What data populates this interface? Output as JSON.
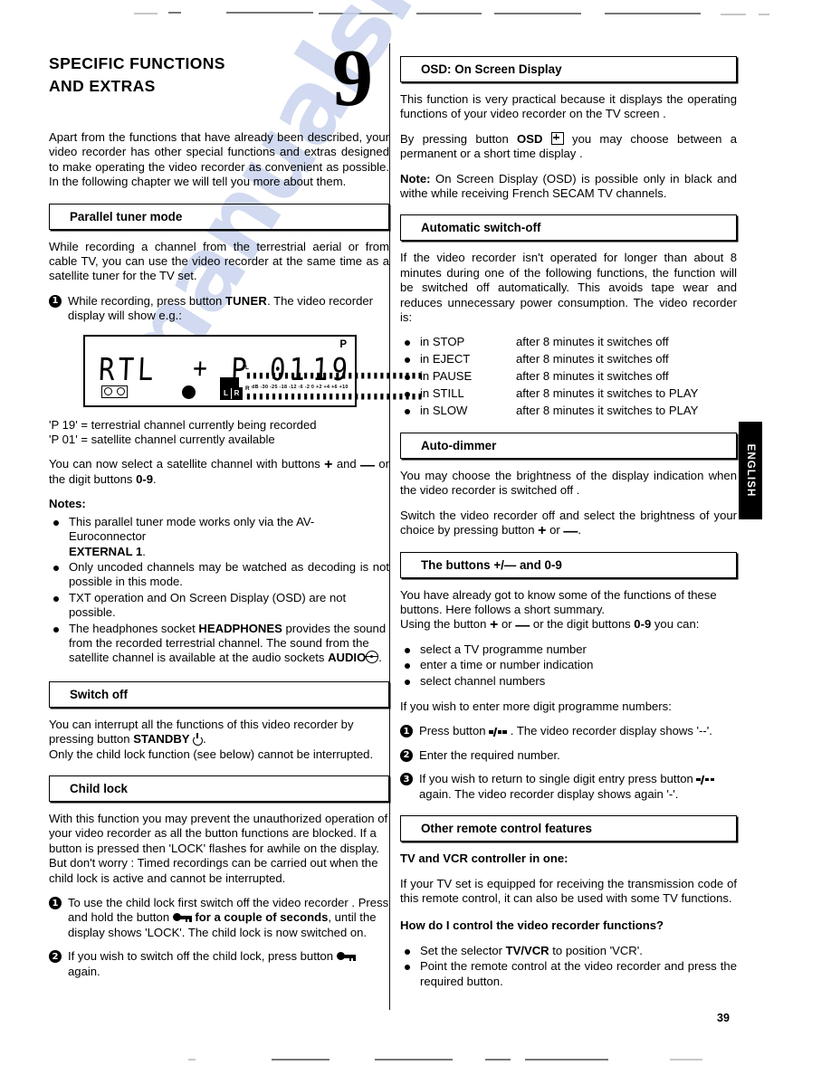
{
  "page": {
    "number": "39",
    "language_tab": "ENGLISH",
    "watermark": "manualslib.com"
  },
  "chapter": {
    "title_line1": "SPECIFIC FUNCTIONS",
    "title_line2": "AND EXTRAS",
    "number": "9",
    "intro": "Apart from the functions that have already been described, your video recorder has other special functions and extras designed to make operating the video recorder as convenient as possible. In the following chapter we will tell you more about them."
  },
  "left": {
    "parallel_tuner": {
      "heading": "Parallel tuner mode",
      "intro": "While recording a channel from the terrestrial aerial or from cable TV, you can use the video recorder at the same time as a satellite tuner for the TV set.",
      "step1_a": "While recording, press button",
      "step1_button": "TUNER",
      "step1_b": ". The video recorder display will show e.g.:",
      "display": {
        "channel_name": "RTL",
        "separator": "+",
        "programme_label": "P",
        "programme_number": "01",
        "terrestrial_number": "19",
        "p_indicator": "P",
        "left_channel_label": "L",
        "right_channel_label": "R",
        "meter_left_tag": "L",
        "meter_right_tag": "R",
        "meter_scale": "dB -30 -25 -18 -12  -6  -2  0 +2  +4  +6  +10",
        "bars": "▮▮▮▮▮▮▮▮▮▮▮▮▮▮▮▮▮▮▮▮▮▮▮▮▮▮▮▮"
      },
      "legend1": "'P 19' = terrestrial channel currently being recorded",
      "legend2": "'P 01' = satellite channel currently available",
      "select_a": "You can now select a satellite channel with buttons",
      "select_plus": "+",
      "select_and": "and",
      "select_minus": "—",
      "select_b": "or the digit buttons",
      "select_digits": "0-9",
      "select_c": ".",
      "notes_title": "Notes:",
      "notes": [
        {
          "text_a": "This parallel tuner mode works only via the AV-Euroconnector",
          "bold": "EXTERNAL 1",
          "text_b": "."
        },
        {
          "text_a": "Only uncoded channels may be watched as decoding is not possible in this mode.",
          "bold": "",
          "text_b": ""
        },
        {
          "text_a": "TXT operation and On Screen Display (OSD) are not possible.",
          "bold": "",
          "text_b": ""
        },
        {
          "text_a": "The headphones socket",
          "bold": "HEADPHONES",
          "text_b": "provides the sound from the recorded terrestrial channel. The sound from the satellite channel is available at the audio sockets",
          "bold2": "AUDIO",
          "text_c": "."
        }
      ]
    },
    "switch_off": {
      "heading": "Switch off",
      "body_a": "You can interrupt all the functions of this video recorder by pressing button",
      "button": "STANDBY",
      "body_b": ".",
      "body_c": "Only the child lock function (see below) cannot be interrupted."
    },
    "child_lock": {
      "heading": "Child lock",
      "body": "With this function you may prevent the unauthorized operation of your video recorder as all the button functions are blocked. If a button is pressed then 'LOCK' flashes for awhile on the display. But don't worry : Timed recordings can be carried out when the child lock is active and cannot be interrupted.",
      "step1_a": "To use the child lock first switch off the video recorder . Press and hold the button",
      "step1_bold": "for a couple of seconds",
      "step1_b": ", until the display shows 'LOCK'. The child lock is now switched on.",
      "step2_a": "If you wish to switch off the child lock, press button",
      "step2_b": "again."
    }
  },
  "right": {
    "osd": {
      "heading": "OSD: On Screen Display",
      "body1": "This function is very practical because it displays the operating functions of your video recorder on the TV screen .",
      "body2_a": "By pressing button",
      "body2_button": "OSD",
      "body2_b": "you may choose between a permanent or a short time display .",
      "note_label": "Note:",
      "note_text": "On Screen Display (OSD) is possible only in black and withe while receiving French SECAM TV channels."
    },
    "auto_switch_off": {
      "heading": "Automatic switch-off",
      "body": "If the video recorder isn't operated for longer than about 8 minutes during one of the following functions, the function will be switched off automatically. This avoids tape wear and reduces unnecessary power consumption. The video recorder is:",
      "rows": [
        {
          "state": "in STOP",
          "result": "after 8 minutes it switches off"
        },
        {
          "state": "in EJECT",
          "result": "after 8 minutes it switches off"
        },
        {
          "state": "in PAUSE",
          "result": "after 8 minutes it switches off"
        },
        {
          "state": "in STILL",
          "result": "after 8 minutes it switches to PLAY"
        },
        {
          "state": "in SLOW",
          "result": "after 8 minutes it switches to PLAY"
        }
      ]
    },
    "auto_dimmer": {
      "heading": "Auto-dimmer",
      "body1": "You may choose the brightness of the display indication when the video recorder is switched off .",
      "body2_a": "Switch the video recorder off and select the brightness of your choice by pressing button",
      "body2_or": "or",
      "body2_b": "."
    },
    "buttons": {
      "heading": "The buttons +/— and 0-9",
      "intro": "You have already got to know some of the functions of these buttons. Here follows a short summary.",
      "using_a": "Using the button",
      "using_or": "or",
      "using_b": "or the digit buttons",
      "using_digits": "0-9",
      "using_c": "you can:",
      "list": [
        "select a TV programme number",
        "enter a time or number indication",
        "select channel numbers"
      ],
      "more_digits": "If you wish to enter more digit programme numbers:",
      "step1_a": "Press button",
      "step1_b": ". The video recorder display shows '--'.",
      "step2": "Enter the required number.",
      "step3_a": "If you wish to return to single digit entry press button",
      "step3_b": "again. The video recorder display shows again '-'."
    },
    "other_remote": {
      "heading": "Other remote control features",
      "subtitle": "TV and VCR controller in one:",
      "body": "If your TV set is equipped for receiving the transmission code of this remote control, it can also be used with some TV functions.",
      "question": "How do I control the video recorder functions?",
      "bullet1_a": "Set the selector",
      "bullet1_bold": "TV/VCR",
      "bullet1_b": "to position 'VCR'.",
      "bullet2": "Point the remote control at the video recorder and press the required button."
    }
  }
}
